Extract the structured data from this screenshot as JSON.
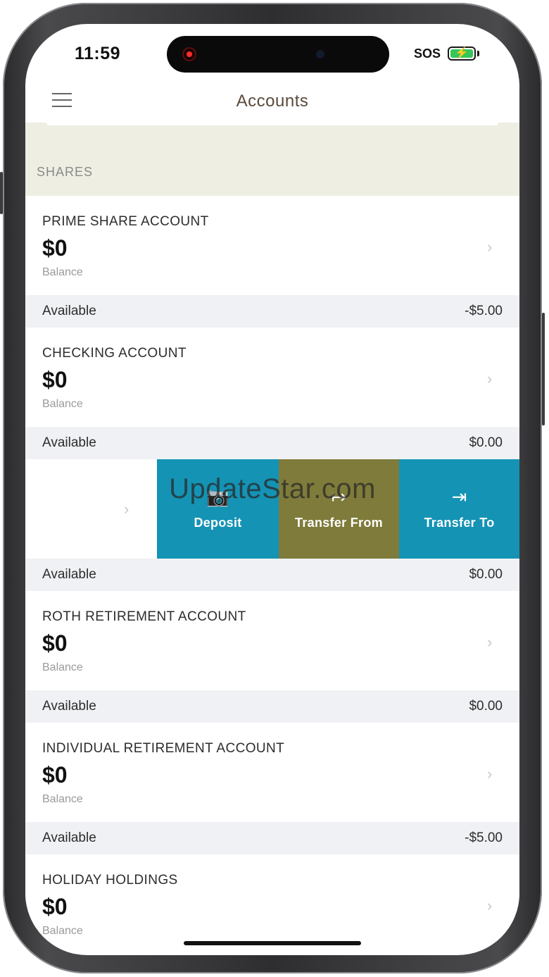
{
  "status_bar": {
    "time": "11:59",
    "carrier": "SOS",
    "battery_glyph": "⚡"
  },
  "nav": {
    "title": "Accounts",
    "menu_icon": "hamburger-menu-icon"
  },
  "section": {
    "label": "SHARES"
  },
  "accounts": [
    {
      "name": "PRIME SHARE ACCOUNT",
      "amount": "$0",
      "balance_label": "Balance",
      "available_label": "Available",
      "available": "-$5.00"
    },
    {
      "name": "CHECKING ACCOUNT",
      "amount": "$0",
      "balance_label": "Balance",
      "available_label": "Available",
      "available": "$0.00"
    }
  ],
  "swipe_row": {
    "available_label": "Available",
    "available": "$0.00",
    "actions": [
      {
        "label": "Deposit",
        "icon": "camera-icon",
        "glyph": "📷",
        "color": "#1493b5"
      },
      {
        "label": "Transfer From",
        "icon": "transfer-from-icon",
        "glyph": "↦",
        "color": "#7f7b3a"
      },
      {
        "label": "Transfer To",
        "icon": "transfer-to-icon",
        "glyph": "⇥",
        "color": "#1493b5"
      }
    ]
  },
  "accounts_after": [
    {
      "name": "ROTH RETIREMENT ACCOUNT",
      "amount": "$0",
      "balance_label": "Balance",
      "available_label": "Available",
      "available": "$0.00"
    },
    {
      "name": "INDIVIDUAL RETIREMENT ACCOUNT",
      "amount": "$0",
      "balance_label": "Balance",
      "available_label": "Available",
      "available": "-$5.00"
    },
    {
      "name": "HOLIDAY HOLDINGS",
      "amount": "$0",
      "balance_label": "Balance"
    }
  ],
  "watermark": "UpdateStar.com",
  "colors": {
    "section_band": "#eeefe2",
    "available_band": "#f0f1f4",
    "title": "#5a4a3a"
  }
}
